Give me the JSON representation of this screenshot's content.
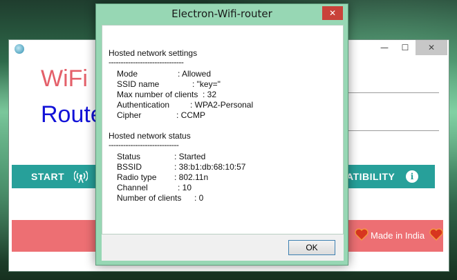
{
  "app": {
    "title_wifi": "WiFi",
    "title_router": "Route",
    "start_label": "START",
    "compat_label": "ATIBILITY",
    "made_label": "Made in India",
    "window_controls": {
      "minimize": "—",
      "maximize": "☐",
      "close": "✕"
    },
    "colors": {
      "teal": "#27a09a",
      "salmon": "#ed6f73",
      "wifi_red": "#e4606a",
      "router_blue": "#1212d8"
    }
  },
  "dialog": {
    "title": "Electron-Wifi-router",
    "close": "✕",
    "ok_label": "OK",
    "settings": {
      "heading": "Hosted network settings",
      "divider": "-------------------------------",
      "rows": [
        {
          "label": "Mode",
          "value": ": Allowed"
        },
        {
          "label": "SSID name",
          "value": ": \"key=\""
        },
        {
          "label": "Max number of clients",
          "value": ": 32"
        },
        {
          "label": "Authentication",
          "value": ": WPA2-Personal"
        },
        {
          "label": "Cipher",
          "value": ": CCMP"
        }
      ]
    },
    "status": {
      "heading": "Hosted network status",
      "divider": "-----------------------------",
      "rows": [
        {
          "label": "Status",
          "value": ": Started"
        },
        {
          "label": "BSSID",
          "value": ": 38:b1:db:68:10:57"
        },
        {
          "label": "Radio type",
          "value": ": 802.11n"
        },
        {
          "label": "Channel",
          "value": ": 10"
        },
        {
          "label": "Number of clients",
          "value": ": 0"
        }
      ]
    }
  }
}
